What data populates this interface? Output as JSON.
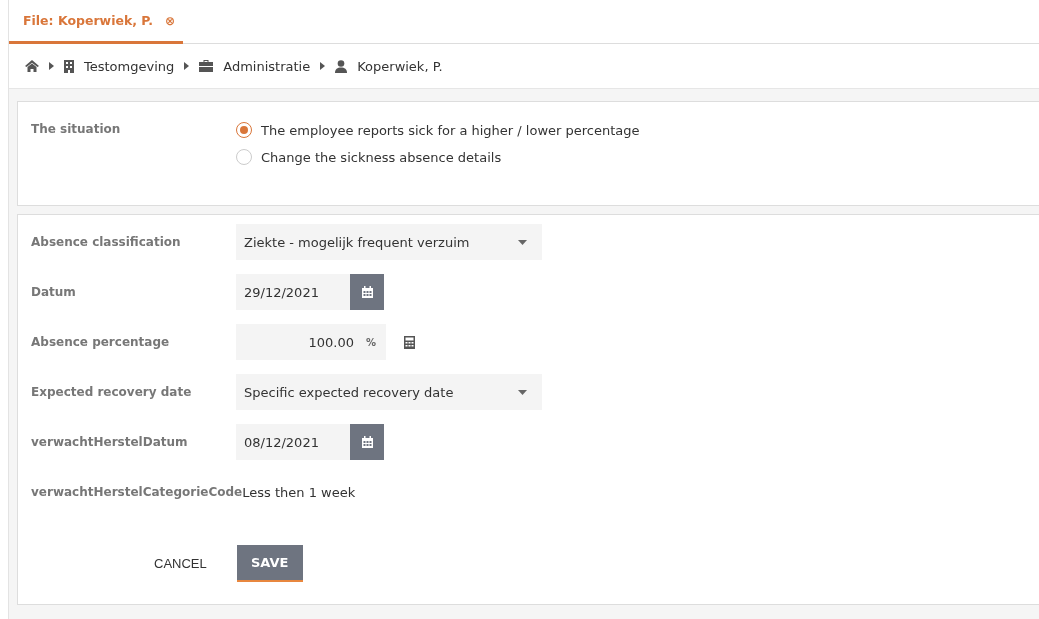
{
  "tab": {
    "label": "File: Koperwiek, P.",
    "selected": true,
    "close": "⊗"
  },
  "breadcrumb": [
    {
      "kind": "home"
    },
    {
      "kind": "building",
      "label": "Testomgeving"
    },
    {
      "kind": "briefcase",
      "label": "Administratie"
    },
    {
      "kind": "person",
      "label": "Koperwiek, P."
    }
  ],
  "situation": {
    "label": "The situation",
    "options": [
      {
        "label": "The employee reports sick for a higher / lower percentage",
        "selected": true
      },
      {
        "label": "Change the sickness absence details",
        "selected": false
      }
    ]
  },
  "fields": [
    {
      "kind": "select",
      "label": "Absence classification",
      "value": "Ziekte - mogelijk frequent verzuim"
    },
    {
      "kind": "date",
      "label": "Datum",
      "value": "29/12/2021"
    },
    {
      "kind": "percent",
      "label": "Absence percentage",
      "value": "100.00",
      "unit": "%"
    },
    {
      "kind": "select",
      "label": "Expected recovery date",
      "value": "Specific expected recovery date"
    },
    {
      "kind": "date",
      "label": "verwachtHerstelDatum",
      "value": "08/12/2021"
    },
    {
      "kind": "text",
      "label": "verwachtHerstelCategorieCode",
      "value": "Less then 1 week"
    }
  ],
  "buttons": {
    "cancel": "CANCEL",
    "save": "SAVE"
  }
}
